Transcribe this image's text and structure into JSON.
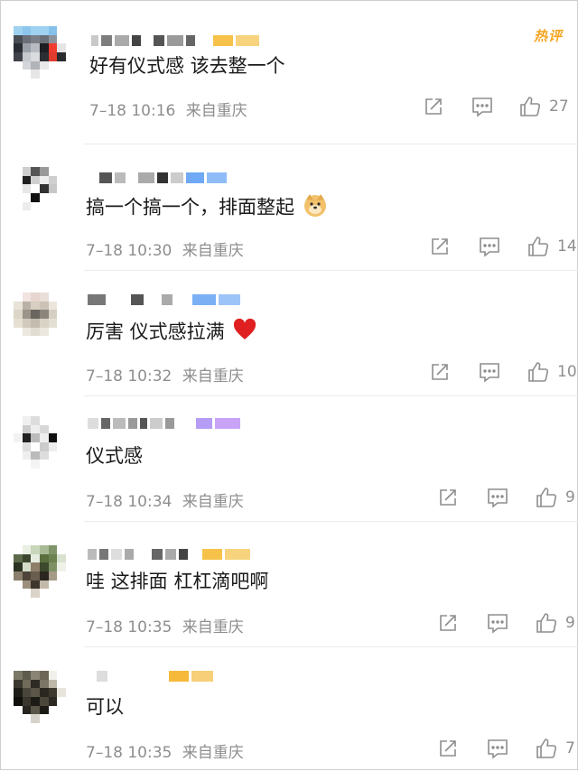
{
  "badge": {
    "hot_label": "热评",
    "color": "#f5a623"
  },
  "comments": [
    {
      "text": "好有仪式感  该去整一个",
      "time": "7–18 10:16",
      "location": "来自重庆",
      "likes": "27",
      "emoji": ""
    },
    {
      "text": "搞一个搞一个，排面整起",
      "time": "7–18 10:30",
      "location": "来自重庆",
      "likes": "14",
      "emoji": "doge-emoji"
    },
    {
      "text": "厉害 仪式感拉满",
      "time": "7–18 10:32",
      "location": "来自重庆",
      "likes": "10",
      "emoji": "heart-emoji"
    },
    {
      "text": "仪式感",
      "time": "7–18 10:34",
      "location": "来自重庆",
      "likes": "9",
      "emoji": ""
    },
    {
      "text": "哇 这排面 杠杠滴吧啊",
      "time": "7–18 10:35",
      "location": "来自重庆",
      "likes": "9",
      "emoji": ""
    },
    {
      "text": "可以",
      "time": "7–18 10:35",
      "location": "来自重庆",
      "likes": "7",
      "emoji": ""
    }
  ],
  "icons": {
    "share": "share-icon",
    "reply": "comment-icon",
    "like": "thumbs-up-icon"
  },
  "colors": {
    "meta_text": "#8e8e8e",
    "heart": "#e02020"
  }
}
